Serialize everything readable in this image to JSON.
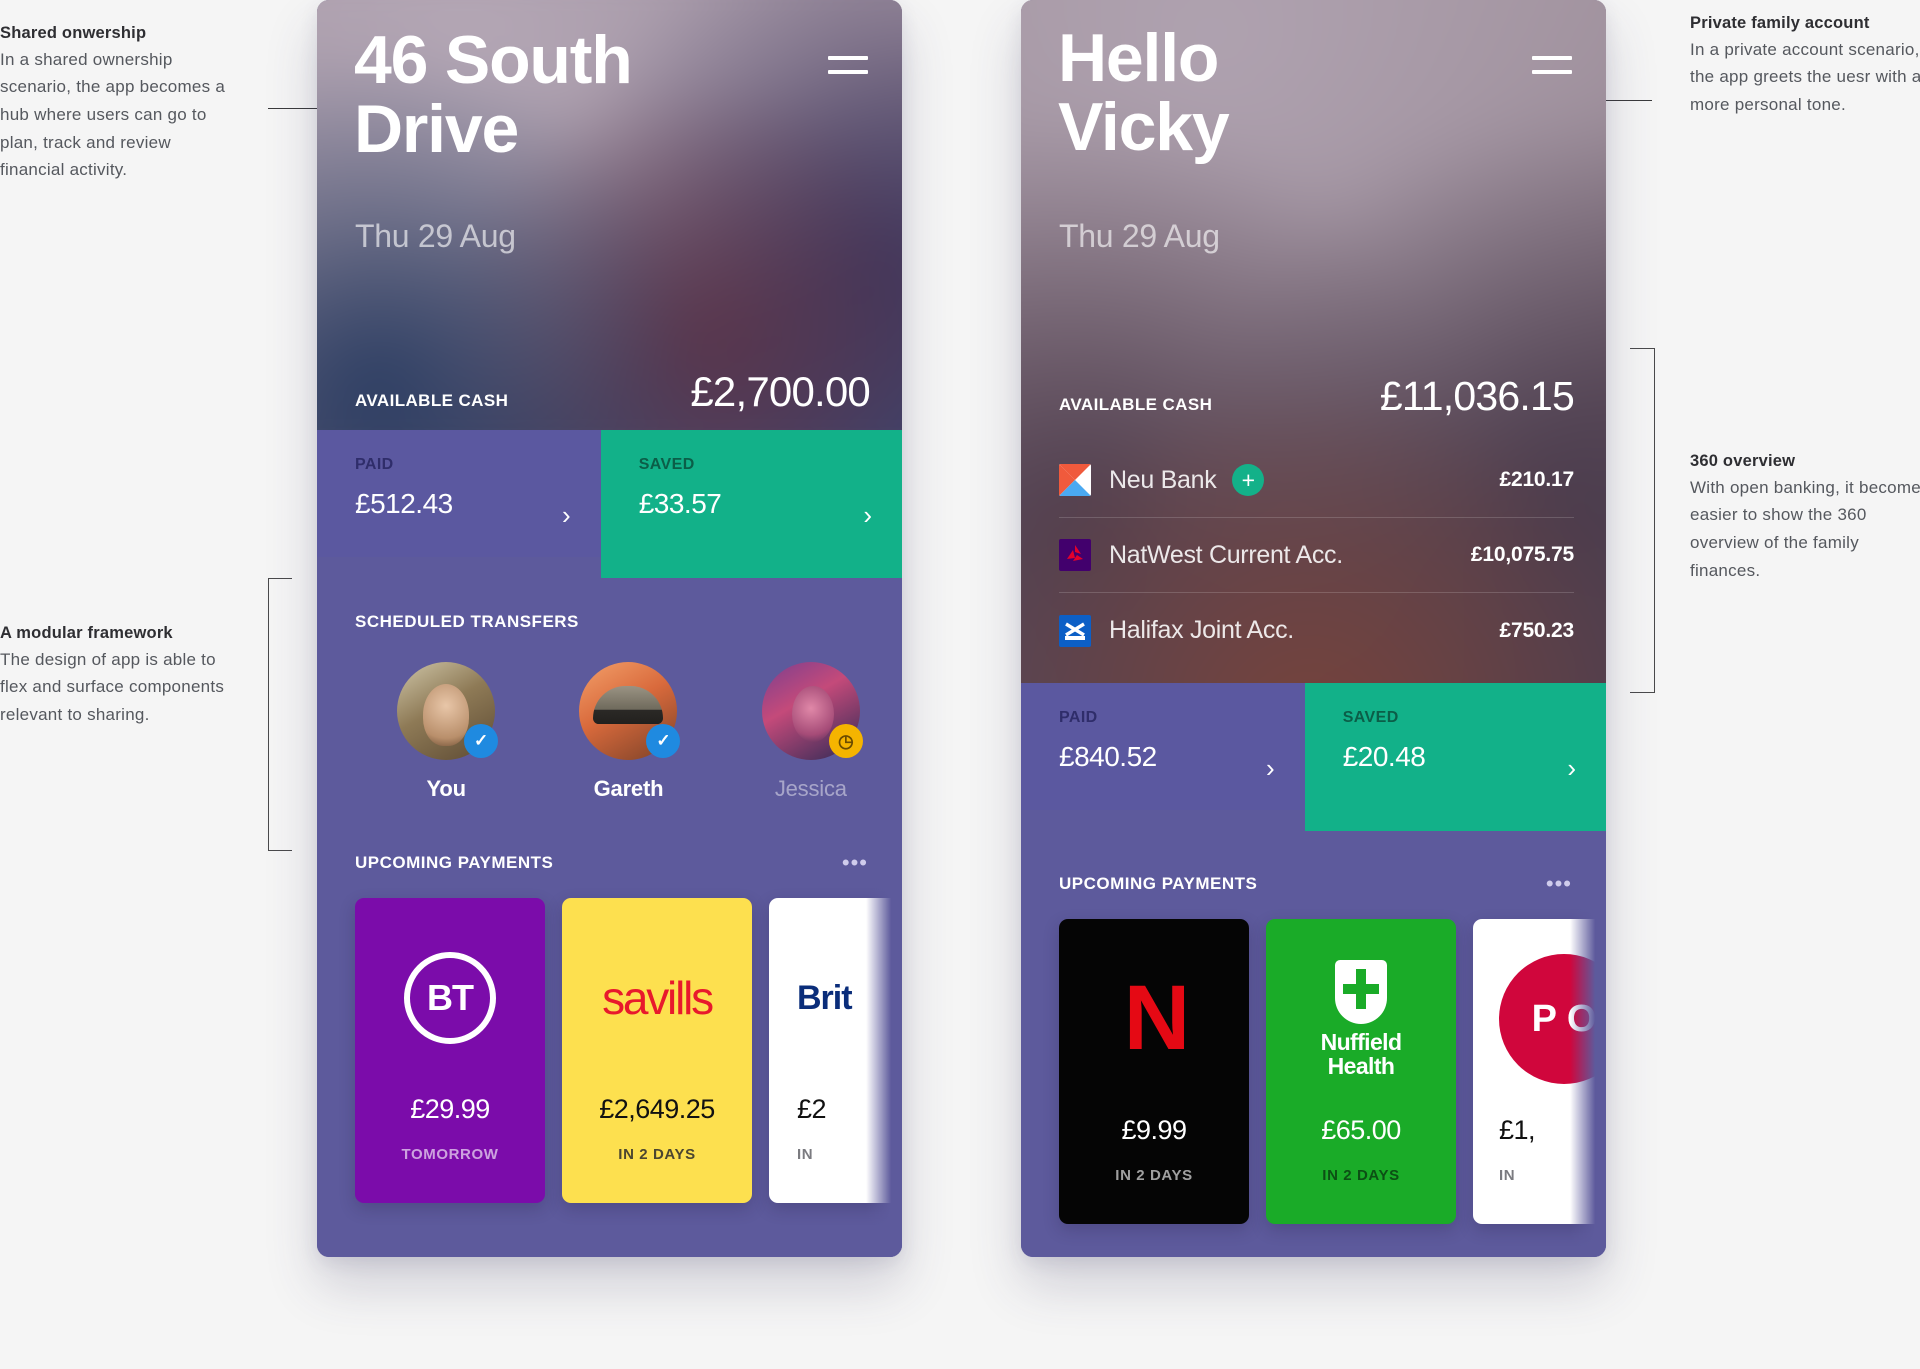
{
  "annotations": {
    "shared": {
      "title": "Shared onwership",
      "body": "In a shared ownership scenario, the app becomes a hub where users can go to plan, track and review financial activity."
    },
    "modular": {
      "title": "A modular framework",
      "body": "The design of app is able to flex and surface components relevant to sharing."
    },
    "private": {
      "title": "Private family account",
      "body": "In a private account scenario, the app greets the uesr with a more personal tone."
    },
    "overview360": {
      "title": "360 overview",
      "body": "With open banking, it becomes easier to show the 360 overview of the family finances."
    }
  },
  "left_phone": {
    "title": "46 South Drive",
    "date": "Thu 29 Aug",
    "menu_icon": "hamburger-icon",
    "cash": {
      "label": "AVAILABLE CASH",
      "value": "£2,700.00"
    },
    "paid": {
      "label": "PAID",
      "value": "£512.43",
      "chevron": "›"
    },
    "saved": {
      "label": "SAVED",
      "value": "£33.57",
      "chevron": "›"
    },
    "transfers": {
      "title": "SCHEDULED TRANSFERS",
      "people": [
        {
          "name": "You",
          "status": "confirmed",
          "badge": "✓",
          "avatar": "avatar-you"
        },
        {
          "name": "Gareth",
          "status": "confirmed",
          "badge": "✓",
          "avatar": "avatar-gareth"
        },
        {
          "name": "Jessica",
          "status": "pending",
          "badge": "◷",
          "avatar": "avatar-jessica"
        }
      ]
    },
    "upcoming": {
      "title": "UPCOMING PAYMENTS",
      "more_icon": "ellipsis-icon",
      "cards": [
        {
          "brand": "BT",
          "logo": "bt-logo",
          "amount": "£29.99",
          "when": "TOMORROW"
        },
        {
          "brand": "savills",
          "logo": "savills-logo",
          "amount": "£2,649.25",
          "when": "IN 2 DAYS"
        },
        {
          "brand": "Brit",
          "logo": "britishgas-logo",
          "amount": "£2",
          "when": "IN"
        }
      ]
    }
  },
  "right_phone": {
    "title": "Hello Vicky",
    "date": "Thu 29 Aug",
    "menu_icon": "hamburger-icon",
    "cash": {
      "label": "AVAILABLE CASH",
      "value": "£11,036.15"
    },
    "accounts": [
      {
        "name": "Neu Bank",
        "logo": "neubank-logo",
        "amount": "£210.17",
        "action": "+"
      },
      {
        "name": "NatWest Current Acc.",
        "logo": "natwest-logo",
        "amount": "£10,075.75",
        "action": ""
      },
      {
        "name": "Halifax Joint Acc.",
        "logo": "halifax-logo",
        "amount": "£750.23",
        "action": ""
      }
    ],
    "paid": {
      "label": "PAID",
      "value": "£840.52",
      "chevron": "›"
    },
    "saved": {
      "label": "SAVED",
      "value": "£20.48",
      "chevron": "›"
    },
    "upcoming": {
      "title": "UPCOMING PAYMENTS",
      "more_icon": "ellipsis-icon",
      "cards": [
        {
          "brand": "Netflix",
          "logo": "netflix-logo",
          "amount": "£9.99",
          "when": "IN 2 DAYS"
        },
        {
          "brand": "Nuffield Health",
          "logo": "nuffield-logo",
          "amount": "£65.00",
          "when": "IN 2 DAYS"
        },
        {
          "brand": "Post Office",
          "logo": "postoffice-logo",
          "amount": "£1,",
          "when": "IN"
        }
      ]
    }
  },
  "brand_marks": {
    "bt": "BT",
    "savills": "savills",
    "britishgas": "Brit",
    "netflix": "N",
    "nuffield_line1": "Nuffield",
    "nuffield_line2": "Health",
    "postoffice": "P O"
  },
  "colors": {
    "purple_body": "#5d5a9c",
    "paid_panel": "#5b58a0",
    "saved_teal": "#12b189",
    "badge_blue": "#1f8ae0",
    "badge_amber": "#f5b400",
    "bt_purple": "#7b0caa",
    "savills_yellow": "#fde04f",
    "netflix_black": "#050505",
    "netflix_red": "#e50914",
    "nuffield_green": "#1aab28",
    "postoffice_red": "#d0063c"
  }
}
